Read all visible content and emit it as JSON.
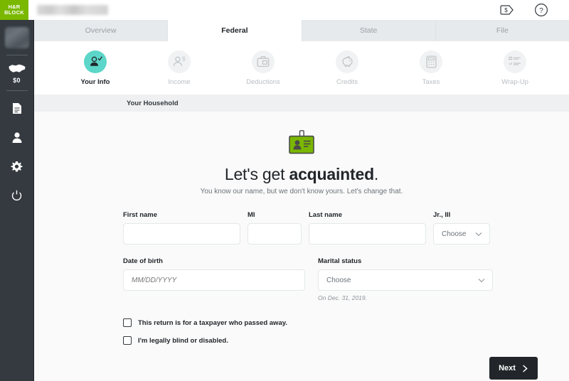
{
  "topbar": {
    "logo_line1": "H&R",
    "logo_line2": "BLOCK",
    "user_name_blurred": "",
    "icons": {
      "price_tag": "price-tag-dollar-icon",
      "help": "help-question-icon"
    }
  },
  "sidebar": {
    "avatar": "user-avatar-thumbnail",
    "refund_amount": "$0",
    "map_icon": "us-map-icon",
    "items": [
      {
        "icon": "document-icon"
      },
      {
        "icon": "person-icon"
      },
      {
        "icon": "gear-icon"
      },
      {
        "icon": "power-icon"
      }
    ]
  },
  "tabs": [
    {
      "label": "Overview",
      "active": false
    },
    {
      "label": "Federal",
      "active": true
    },
    {
      "label": "State",
      "active": false
    },
    {
      "label": "File",
      "active": false
    }
  ],
  "steps": [
    {
      "label": "Your Info",
      "icon": "person-check-icon",
      "active": true
    },
    {
      "label": "Income",
      "icon": "person-dollar-icon",
      "active": false
    },
    {
      "label": "Deductions",
      "icon": "briefcase-icon",
      "active": false
    },
    {
      "label": "Credits",
      "icon": "piggy-bank-icon",
      "active": false
    },
    {
      "label": "Taxes",
      "icon": "calculator-icon",
      "active": false
    },
    {
      "label": "Wrap-Up",
      "icon": "checklist-icon",
      "active": false
    }
  ],
  "breadcrumb": "Your Household",
  "hero": {
    "badge_icon": "id-badge-icon",
    "headline_light": "Let's get ",
    "headline_bold": "acquainted",
    "headline_period": ".",
    "subhead": "You know our name, but we don't know yours. Let's change that."
  },
  "form": {
    "first_name": {
      "label": "First name",
      "value": "",
      "placeholder": ""
    },
    "middle_initial": {
      "label": "MI",
      "value": "",
      "placeholder": ""
    },
    "last_name": {
      "label": "Last name",
      "value": "",
      "placeholder": ""
    },
    "suffix": {
      "label": "Jr., III",
      "value": "Choose"
    },
    "date_of_birth": {
      "label": "Date of birth",
      "value": "",
      "placeholder": "MM/DD/YYYY"
    },
    "marital_status": {
      "label": "Marital status",
      "value": "Choose",
      "helper": "On Dec. 31, 2019."
    }
  },
  "checkboxes": [
    {
      "label": "This return is for a taxpayer who passed away.",
      "checked": false
    },
    {
      "label": "I'm legally blind or disabled.",
      "checked": false
    }
  ],
  "next_button": {
    "label": "Next",
    "icon": "chevron-right-icon"
  },
  "colors": {
    "brand_green": "#7ab800",
    "accent_teal": "#5cd6c8",
    "sidebar_dark": "#343a40",
    "button_dark": "#22262a"
  }
}
